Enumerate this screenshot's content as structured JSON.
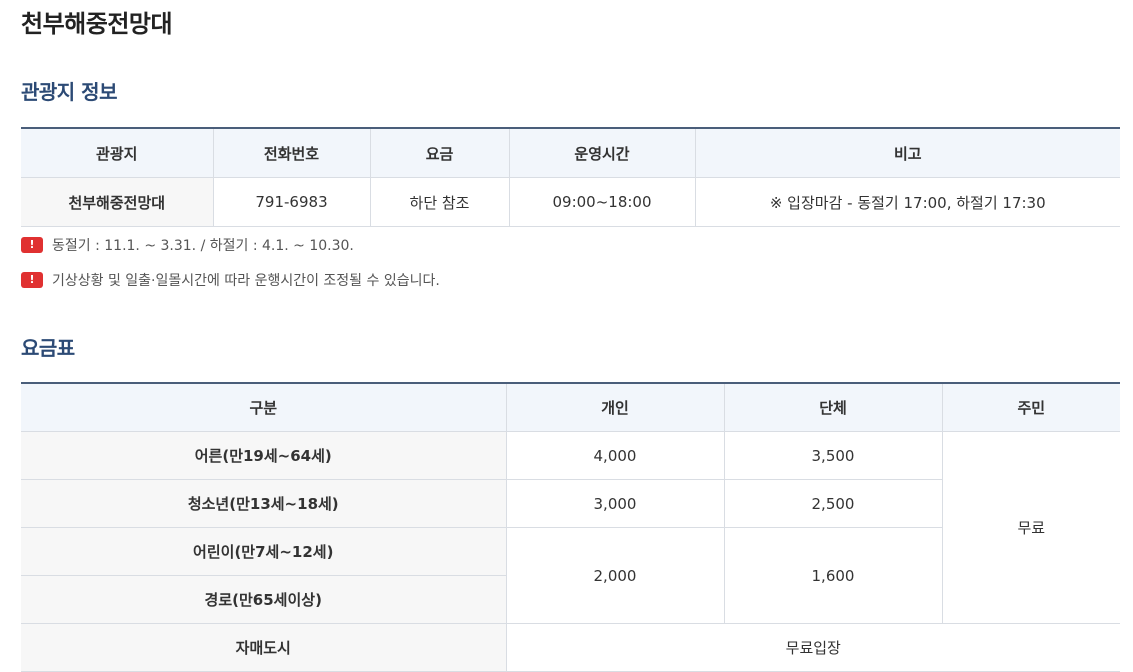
{
  "page_title": "천부해중전망대",
  "info_section": {
    "title": "관광지 정보",
    "headers": [
      "관광지",
      "전화번호",
      "요금",
      "운영시간",
      "비고"
    ],
    "row": {
      "name": "천부해중전망대",
      "phone": "791-6983",
      "fee": "하단 참조",
      "hours": "09:00~18:00",
      "remark": "※ 입장마감 - 동절기 17:00, 하절기 17:30"
    },
    "notes": [
      {
        "icon": "alert-icon",
        "text": "동절기 : 11.1. ~ 3.31. / 하절기 : 4.1. ~ 10.30."
      },
      {
        "icon": "alert-icon",
        "text": "기상상황 및 일출·일몰시간에 따라 운행시간이 조정될 수 있습니다."
      }
    ],
    "alert_glyph": "!"
  },
  "fee_section": {
    "title": "요금표",
    "headers": [
      "구분",
      "개인",
      "단체",
      "주민"
    ],
    "rows": {
      "adult": {
        "label": "어른(만19세~64세)",
        "individual": "4,000",
        "group": "3,500"
      },
      "youth": {
        "label": "청소년(만13세~18세)",
        "individual": "3,000",
        "group": "2,500"
      },
      "child": {
        "label": "어린이(만7세~12세)"
      },
      "senior": {
        "label": "경로(만65세이상)"
      },
      "child_senior": {
        "individual": "2,000",
        "group": "1,600"
      },
      "resident_fee": "무료",
      "sister_city": {
        "label": "자매도시",
        "fee": "무료입장"
      }
    }
  },
  "colors": {
    "section_title": "#2c4a75",
    "alert": "#e03131",
    "header_bg": "#f2f6fb",
    "table_top_border": "#4a5e7a"
  }
}
